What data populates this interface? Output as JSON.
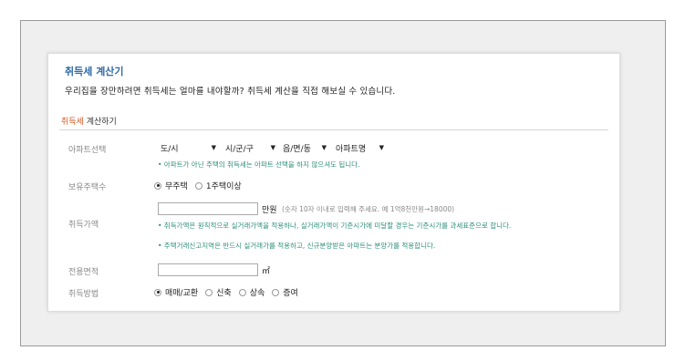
{
  "calculator": {
    "title": "취득세 계산기",
    "description": "우리집을 장만하려면 취득세는 얼마를 내야할까? 취득세 계산을 직접 해보실 수 있습니다.",
    "section_accent": "취득세",
    "section_rest": " 계산하기"
  },
  "apartment": {
    "label": "아파트선택",
    "selects": [
      "도/시",
      "시/군/구",
      "읍/면/동",
      "아파트명"
    ],
    "note": "• 아파트가 아닌 주택의 취득세는 아파트 선택을 하지 않으셔도 됩니다."
  },
  "owned": {
    "label": "보유주택수",
    "options": [
      "무주택",
      "1주택이상"
    ],
    "selected": 0
  },
  "price": {
    "label": "취득가액",
    "value": "",
    "unit": "만원",
    "hint": "(숫자 10자 이내로 입력해 주세요. 예 1억8천만원→18000)",
    "notes": [
      "• 취득가액은 원칙적으로 실거래가액을 적용하나, 실거래가액이 기준시가에 미달할 경우는 기준시가를 과세표준으로 합니다.",
      "• 주택거래신고지역은 반드시 실거래가를 적용하고, 신규분양받은 아파트는 분양가를 적용합니다."
    ]
  },
  "area": {
    "label": "전용면적",
    "value": "",
    "unit": "㎡"
  },
  "method": {
    "label": "취득방법",
    "options": [
      "매매/교환",
      "신축",
      "상속",
      "증여"
    ],
    "selected": 0
  },
  "colors": {
    "title": "#2e6aa6",
    "accent": "#d9531e",
    "note": "#2f8f7a"
  }
}
